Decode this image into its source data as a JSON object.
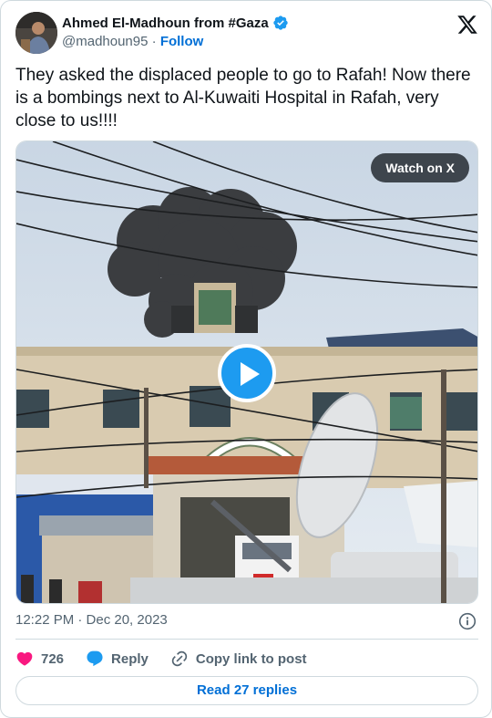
{
  "author": {
    "display_name": "Ahmed El-Madhoun from #Gaza",
    "handle": "@madhoun95",
    "separator": " · ",
    "follow_label": "Follow",
    "verified": true
  },
  "tweet": {
    "text": "They asked the displaced people to go to Rafah! Now there is a bombings next to Al-Kuwaiti Hospital in Rafah, very close to us!!!!",
    "timestamp": "12:22 PM · Dec 20, 2023"
  },
  "media": {
    "type": "video",
    "watch_label": "Watch on X"
  },
  "actions": {
    "like_count": "726",
    "reply_label": "Reply",
    "copy_link_label": "Copy link to post"
  },
  "read_replies_label": "Read 27 replies",
  "colors": {
    "brand_blue": "#1d9bf0",
    "link_blue": "#006fd6",
    "like_red": "#f91880",
    "secondary_text": "#536471",
    "border": "#cfd9de"
  },
  "icons": [
    "x-logo-icon",
    "verified-badge-icon",
    "play-icon",
    "info-icon",
    "heart-icon",
    "reply-bubble-icon",
    "link-icon"
  ]
}
